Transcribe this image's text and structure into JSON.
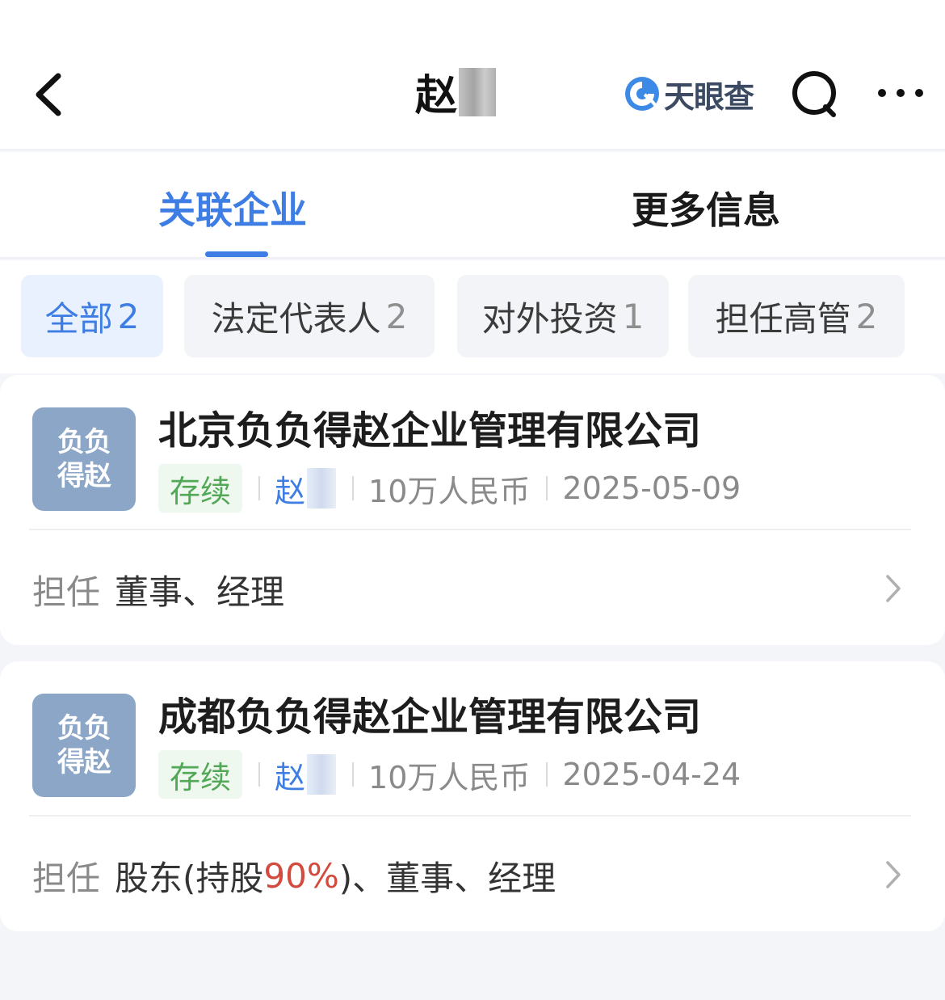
{
  "nav": {
    "title": "赵",
    "brand": "天眼查"
  },
  "tabs": [
    {
      "label": "关联企业",
      "active": true
    },
    {
      "label": "更多信息",
      "active": false
    }
  ],
  "filters": [
    {
      "label": "全部",
      "count": "2",
      "active": true
    },
    {
      "label": "法定代表人",
      "count": "2",
      "active": false
    },
    {
      "label": "对外投资",
      "count": "1",
      "active": false
    },
    {
      "label": "担任高管",
      "count": "2",
      "active": false
    }
  ],
  "companies": [
    {
      "avatar_text": "负负得赵",
      "name": "北京负负得赵企业管理有限公司",
      "status": "存续",
      "legal_rep": "赵",
      "capital": "10万人民币",
      "date": "2025-05-09",
      "role_prefix": "担任",
      "role_before": "董事、经理",
      "role_pct": "",
      "role_after": ""
    },
    {
      "avatar_text": "负负得赵",
      "name": "成都负负得赵企业管理有限公司",
      "status": "存续",
      "legal_rep": "赵",
      "capital": "10万人民币",
      "date": "2025-04-24",
      "role_prefix": "担任",
      "role_before": "股东(持股",
      "role_pct": "90%",
      "role_after": ")、董事、经理"
    }
  ],
  "colors": {
    "accent": "#3d7de4",
    "status_green": "#52a857",
    "percent_red": "#d24b3e",
    "avatar_bg": "#8ca6c7"
  }
}
